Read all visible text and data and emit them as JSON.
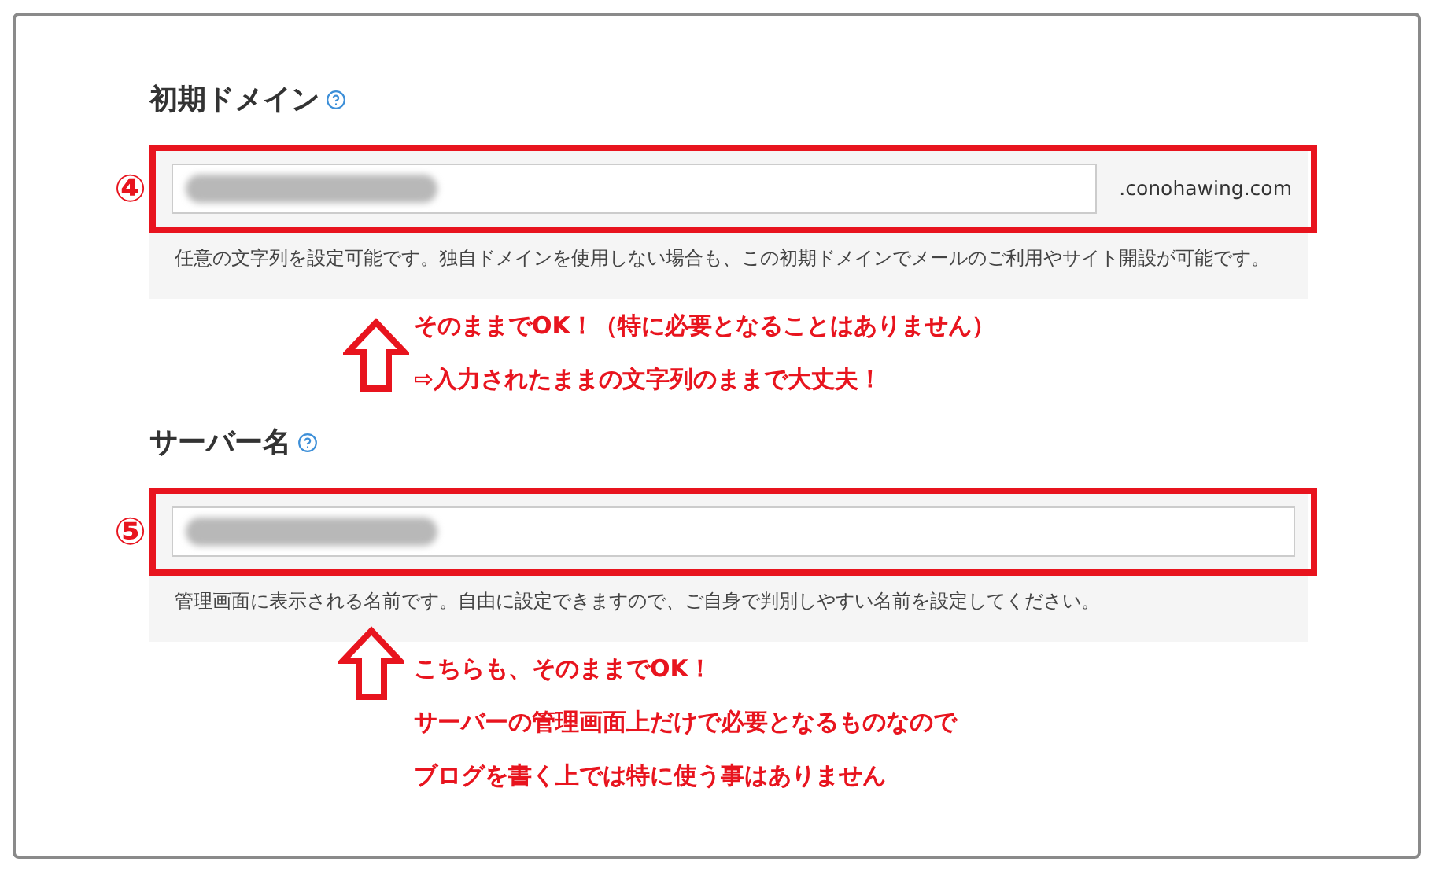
{
  "sections": [
    {
      "label": "初期ドメイン",
      "badge": "④",
      "redacted": true,
      "suffix": ".conohawing.com",
      "help": "任意の文字列を設定可能です。独自ドメインを使用しない場合も、この初期ドメインでメールのご利用やサイト開設が可能です。",
      "notes": [
        "そのままでOK！（特に必要となることはありません）",
        "⇨入力されたままの文字列のままで大丈夫！"
      ]
    },
    {
      "label": "サーバー名",
      "badge": "⑤",
      "redacted": true,
      "help": "管理画面に表示される名前です。自由に設定できますので、ご自身で判別しやすい名前を設定してください。",
      "notes": [
        "こちらも、そのままでOK！",
        "サーバーの管理画面上だけで必要となるものなので",
        "ブログを書く上では特に使う事はありません"
      ]
    }
  ]
}
